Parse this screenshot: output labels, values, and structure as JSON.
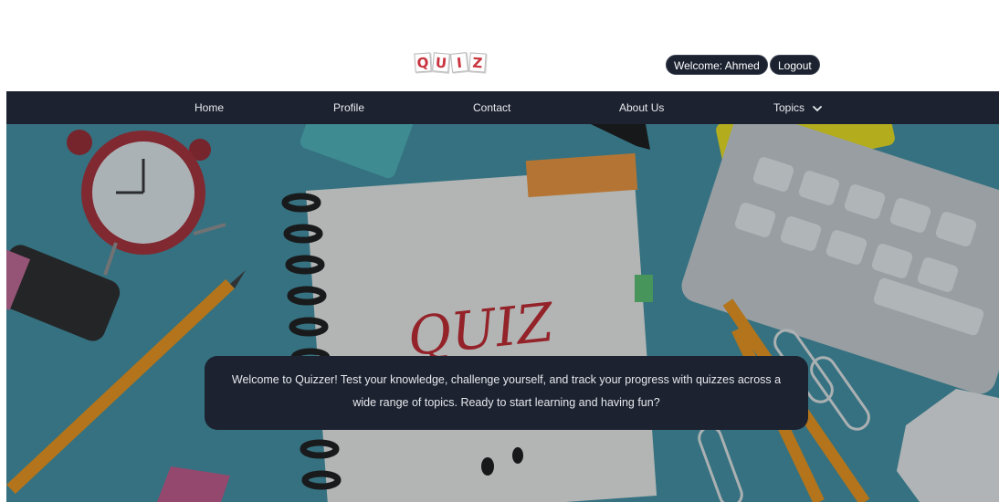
{
  "logo": {
    "letters": [
      "Q",
      "U",
      "I",
      "Z"
    ]
  },
  "header": {
    "welcome_text": "Welcome: Ahmed",
    "logout_label": "Logout"
  },
  "nav": {
    "items": [
      {
        "label": "Home"
      },
      {
        "label": "Profile"
      },
      {
        "label": "Contact"
      },
      {
        "label": "About Us"
      },
      {
        "label": "Topics"
      }
    ],
    "topics_icon": "chevron-down-icon"
  },
  "hero": {
    "notebook_text": "QUIZ",
    "message": "Welcome to Quizzer! Test your knowledge, challenge yourself, and track your progress with quizzes across a wide range of topics. Ready to start learning and having fun?"
  },
  "colors": {
    "nav_bg": "#1c2230",
    "hero_bg": "#3b8190",
    "logo_red": "#c8323c"
  }
}
